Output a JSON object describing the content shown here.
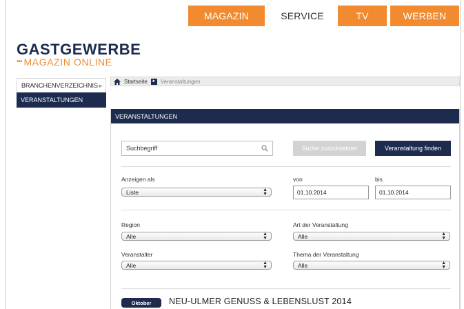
{
  "topnav": {
    "tabs": [
      {
        "label": "MAGAZIN"
      },
      {
        "label": "SERVICE"
      },
      {
        "label": "TV"
      },
      {
        "label": "WERBEN"
      }
    ]
  },
  "logo": {
    "main": "GASTGEWERBE",
    "dots": "•••",
    "sub": "MAGAZIN ONLINE"
  },
  "sidebar": {
    "items": [
      {
        "label": "BRANCHENVERZEICHNIS",
        "chevron": "►"
      },
      {
        "label": "VERANSTALTUNGEN"
      }
    ]
  },
  "breadcrumb": {
    "home": "Startseite",
    "arrow": "►",
    "current": "Veranstaltungen"
  },
  "panel": {
    "title": "VERANSTALTUNGEN",
    "search": {
      "value": "Suchbegriff"
    },
    "reset_label": "Suche zurücksetzen",
    "find_label": "Veranstaltung finden",
    "display_label": "Anzeigen als",
    "display_value": "Liste",
    "from_label": "von",
    "from_value": "01.10.2014",
    "to_label": "bis",
    "to_value": "01.10.2014",
    "region_label": "Region",
    "region_value": "Alle",
    "type_label": "Art der Veranstaltung",
    "type_value": "Alle",
    "organizer_label": "Veranstalter",
    "organizer_value": "Alle",
    "topic_label": "Thema der Veranstaltung",
    "topic_value": "Alle",
    "select_arrow_up": "▲",
    "select_arrow_down": "▼"
  },
  "event": {
    "month": "Oktober",
    "title": "NEU-ULMER GENUSS & LEBENSLUST 2014"
  },
  "colors": {
    "accent_orange": "#f28b30",
    "navy": "#1d2b4f",
    "reset_button": "#d3d3d3"
  },
  "icons": [
    "home-icon",
    "search-icon",
    "chevron-right-icon",
    "select-arrows-icon"
  ]
}
